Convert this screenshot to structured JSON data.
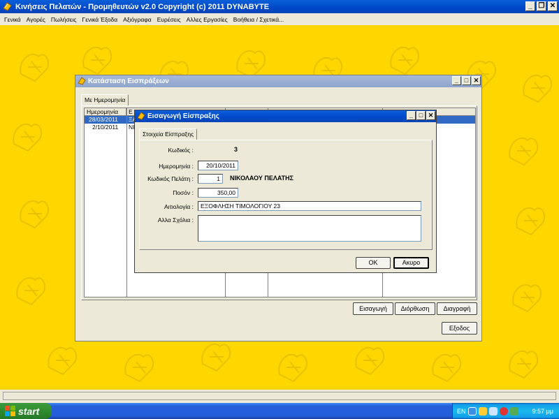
{
  "app": {
    "title": "Κινήσεις Πελατών - Προμηθευτών  v2.0   Copyright (c) 2011  DYNABYTE",
    "menu": [
      "Γενικά",
      "Αγορές",
      "Πωλήσεις",
      "Γενικά Έξοδα",
      "Αξιόγραφα",
      "Ευρέσεις",
      "Αλλες Εργασίες",
      "Βοήθεια / Σχετικά..."
    ],
    "controls": {
      "minimize": "_",
      "restore": "❐",
      "close": "✕"
    }
  },
  "receipts_window": {
    "title": "Κατάσταση Εισπράξεων",
    "tab": "Με Ημερομηνία",
    "columns": [
      "Ημερομηνία",
      "Ε"
    ],
    "rows": [
      {
        "date": "28/03/2011",
        "desc": "ΞΑ"
      },
      {
        "date": "2/10/2011",
        "desc": "ΝΙΚ"
      }
    ],
    "buttons": {
      "insert": "Εισαγωγή",
      "edit": "Διόρθωση",
      "delete": "Διαγραφή",
      "exit": "Εξοδος"
    }
  },
  "entry_dialog": {
    "title": "Εισαγωγή Είσπραξης",
    "tab": "Στοιχεία Είσπραξης",
    "labels": {
      "code": "Κωδικός :",
      "date": "Ημερομηνία :",
      "customer_code": "Κωδικός Πελάτη :",
      "amount": "Ποσόν :",
      "reason": "Αιτιολογία :",
      "notes": "Αλλα Σχόλια :"
    },
    "values": {
      "code": "3",
      "date": "20/10/2011",
      "customer_code": "1",
      "customer_name": "ΝΙΚΟΛΑΟΥ ΠΕΛΑΤΗΣ",
      "amount": "350,00",
      "reason": "ΕΞΟΦΛΗΣΗ ΤΙΜΟΛΟΓΙΟΥ 23",
      "notes": ""
    },
    "buttons": {
      "ok": "OK",
      "cancel": "Ακυρο"
    }
  },
  "taskbar": {
    "start": "start",
    "language": "EN",
    "clock": "9:57 μμ"
  },
  "colors": {
    "desktop": "#ffd700",
    "title_active": "#0048c8",
    "selection": "#316ac5"
  }
}
